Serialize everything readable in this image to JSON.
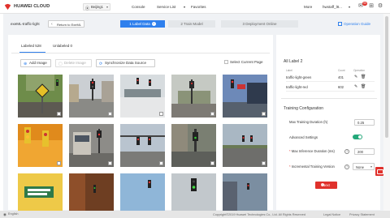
{
  "topbar": {
    "brand": "HUAWEI CLOUD",
    "region": "Beijing1",
    "links": [
      "Console",
      "Service List",
      "Favorites"
    ],
    "service_caret": "▾",
    "more": "More",
    "user": "hwstaff_l8...",
    "user_caret": "▾",
    "notif_count": "99"
  },
  "steps": {
    "job_name": "exeML-traffic-light",
    "back_label": "Return to ExeML",
    "s1": "1 Label Data",
    "s2": "2 Train Model",
    "s3": "3 Deployment Online",
    "ops_guide": "Operation Guide"
  },
  "tabs": {
    "labeled": "Labeled 528",
    "unlabeled": "Unlabeled 0"
  },
  "toolbar": {
    "add_image": "Add Image",
    "delete_image": "Delete Image",
    "sync": "Synchronize Data Source",
    "select_page": "Select Current Page"
  },
  "labels_panel": {
    "title": "All Label",
    "count": "2",
    "col_label": "Label",
    "col_count": "Count",
    "col_operation": "Operation",
    "rows": [
      {
        "name": "traffic-light-green",
        "count": "401"
      },
      {
        "name": "traffic-light-red",
        "count": "602"
      }
    ]
  },
  "training": {
    "title": "Training Configuration",
    "max_duration_label": "Max Training Duration (h)",
    "max_duration_value": "0.25",
    "advanced_label": "Advanced Settings",
    "advanced_enabled": true,
    "inference_label": "Max Inference Duration (ms)",
    "inference_value": "200",
    "incremental_label": "Incremental Training Version",
    "incremental_value": "None",
    "next_label": "Next"
  },
  "footer": {
    "language": "English",
    "copyright": "Copyright©2019 Huawei Technologies Co., Ltd. All Rights Reserved",
    "legal": "Legal Notice",
    "privacy": "Privacy Statement"
  },
  "colors": {
    "accent": "#2f80ed",
    "brand_red": "#e0312c",
    "toggle_on": "#24a87a"
  }
}
